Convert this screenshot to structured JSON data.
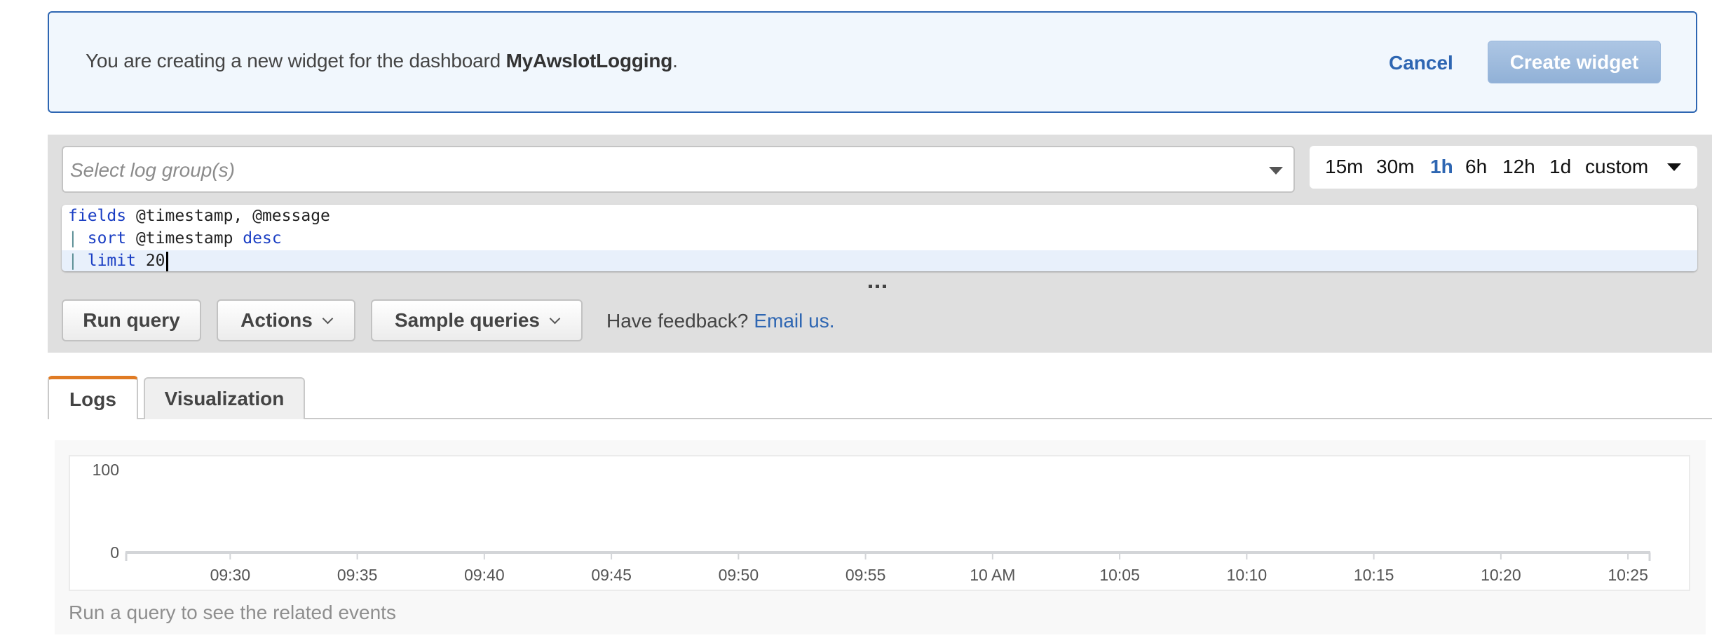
{
  "banner": {
    "message_prefix": "You are creating a new widget for the dashboard ",
    "dashboard_name": "MyAwsIotLogging",
    "message_suffix": ".",
    "cancel_label": "Cancel",
    "create_label": "Create widget"
  },
  "query": {
    "log_group_placeholder": "Select log group(s)",
    "time_ranges": [
      {
        "label": "15m",
        "active": false
      },
      {
        "label": "30m",
        "active": false
      },
      {
        "label": "1h",
        "active": true
      },
      {
        "label": "6h",
        "active": false
      },
      {
        "label": "12h",
        "active": false
      },
      {
        "label": "1d",
        "active": false
      },
      {
        "label": "custom",
        "active": false
      }
    ],
    "editor_lines": [
      [
        {
          "t": "fields",
          "c": "kw"
        },
        {
          "t": " @timestamp, @message",
          "c": ""
        }
      ],
      [
        {
          "t": "|",
          "c": "pipe"
        },
        {
          "t": " ",
          "c": ""
        },
        {
          "t": "sort",
          "c": "kw"
        },
        {
          "t": " @timestamp ",
          "c": ""
        },
        {
          "t": "desc",
          "c": "kw"
        }
      ],
      [
        {
          "t": "|",
          "c": "pipe"
        },
        {
          "t": " ",
          "c": ""
        },
        {
          "t": "limit",
          "c": "kw"
        },
        {
          "t": " 20",
          "c": ""
        }
      ]
    ],
    "run_label": "Run query",
    "actions_label": "Actions",
    "sample_label": "Sample queries",
    "feedback_text": "Have feedback?",
    "feedback_link": "Email us."
  },
  "tabs": [
    {
      "label": "Logs",
      "active": true
    },
    {
      "label": "Visualization",
      "active": false
    }
  ],
  "chart_data": {
    "type": "bar",
    "title": "",
    "xlabel": "",
    "ylabel": "",
    "ylim": [
      0,
      100
    ],
    "y_ticks": [
      "100",
      "0"
    ],
    "x_range": [
      "09:25:53",
      "10:25:53"
    ],
    "x_ticks": [
      "09:30",
      "09:35",
      "09:40",
      "09:45",
      "09:50",
      "09:55",
      "10 AM",
      "10:05",
      "10:10",
      "10:15",
      "10:20",
      "10:25"
    ],
    "x_tick_minutes": [
      30,
      35,
      40,
      45,
      50,
      55,
      60,
      65,
      70,
      75,
      80,
      85
    ],
    "x_range_minutes": [
      25.88,
      85.88
    ],
    "series": [],
    "grid": false
  },
  "results": {
    "empty_message": "Run a query to see the related events"
  },
  "colors": {
    "accent": "#2e66b2",
    "tab_active": "#e07b24",
    "panel_gray": "#dfdfdf"
  }
}
